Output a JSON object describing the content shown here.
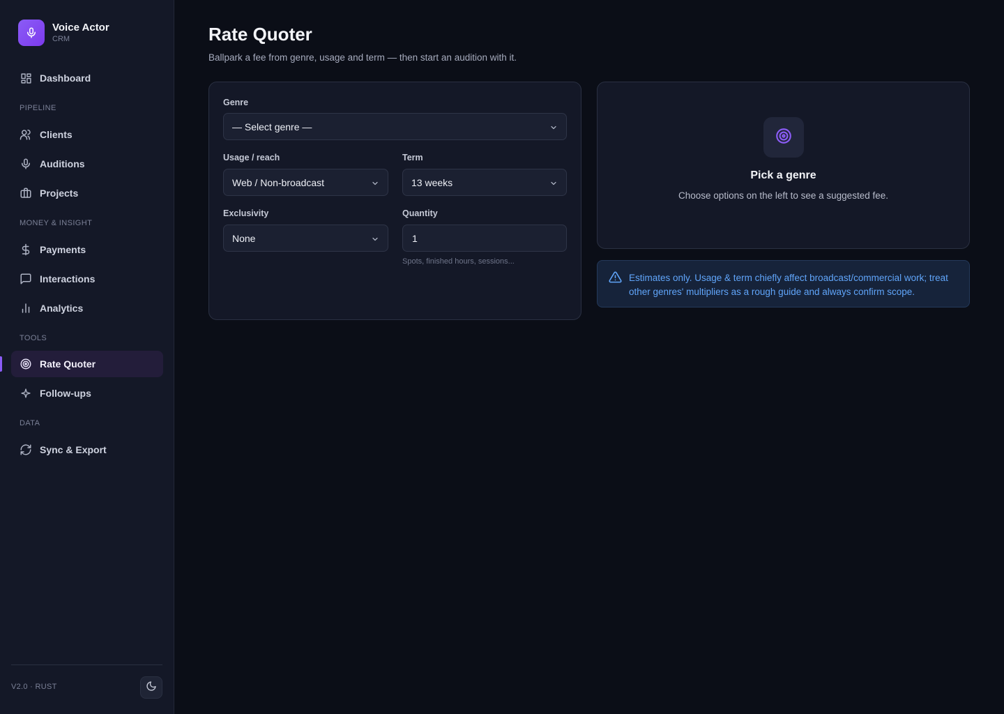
{
  "brand": {
    "title": "Voice Actor",
    "subtitle": "CRM"
  },
  "sidebar": {
    "dashboard": "Dashboard",
    "sections": [
      "PIPELINE",
      "MONEY & INSIGHT",
      "TOOLS",
      "DATA"
    ],
    "items": [
      {
        "label": "Clients",
        "icon": "users-icon"
      },
      {
        "label": "Auditions",
        "icon": "microphone-icon"
      },
      {
        "label": "Projects",
        "icon": "briefcase-icon"
      },
      {
        "label": "Payments",
        "icon": "dollar-icon"
      },
      {
        "label": "Interactions",
        "icon": "message-icon"
      },
      {
        "label": "Analytics",
        "icon": "bar-chart-icon"
      },
      {
        "label": "Rate Quoter",
        "icon": "target-icon",
        "active": true
      },
      {
        "label": "Follow-ups",
        "icon": "sparkle-icon"
      },
      {
        "label": "Sync & Export",
        "icon": "refresh-icon"
      }
    ],
    "version": "V2.0 · RUST"
  },
  "page": {
    "title": "Rate Quoter",
    "subtitle": "Ballpark a fee from genre, usage and term — then start an audition with it."
  },
  "form": {
    "genre_label": "Genre",
    "genre_value": "— Select genre —",
    "usage_label": "Usage / reach",
    "usage_value": "Web / Non-broadcast",
    "term_label": "Term",
    "term_value": "13 weeks",
    "exclusivity_label": "Exclusivity",
    "exclusivity_value": "None",
    "quantity_label": "Quantity",
    "quantity_value": "1",
    "quantity_hint": "Spots, finished hours, sessions..."
  },
  "result": {
    "title": "Pick a genre",
    "text": "Choose options on the left to see a suggested fee."
  },
  "notice": {
    "text": "Estimates only. Usage & term chiefly affect broadcast/commercial work; treat other genres' multipliers as a rough guide and always confirm scope."
  },
  "colors": {
    "accent": "#8b5cf6",
    "info": "#60a5fa",
    "background": "#0b0e17",
    "sidebar": "#141827"
  }
}
